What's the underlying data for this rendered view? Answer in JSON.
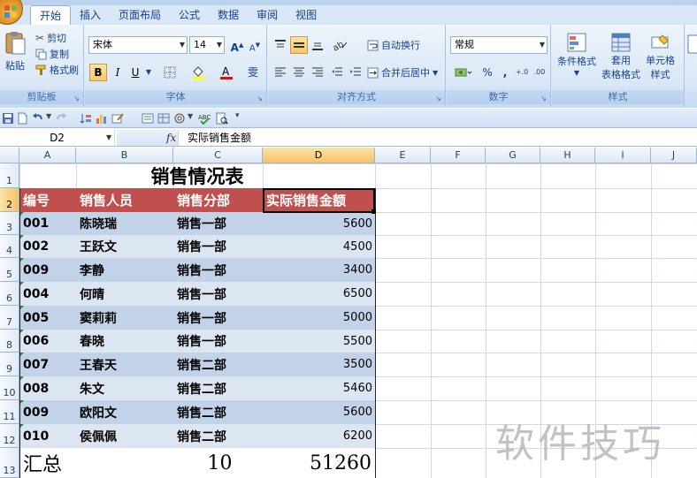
{
  "ribbon": {
    "tabs": [
      "开始",
      "插入",
      "页面布局",
      "公式",
      "数据",
      "审阅",
      "视图"
    ],
    "active_tab": "开始",
    "clipboard": {
      "paste": "粘贴",
      "cut": "剪切",
      "copy": "复制",
      "format_painter": "格式刷",
      "label": "剪贴板"
    },
    "font": {
      "name": "宋体",
      "size": "14",
      "bold": "B",
      "italic": "I",
      "underline": "U",
      "grow": "A",
      "shrink": "A",
      "phonetic": "雯",
      "label": "字体"
    },
    "alignment": {
      "wrap_text": "自动换行",
      "merge_center": "合并后居中",
      "label": "对齐方式"
    },
    "number": {
      "format": "常规",
      "percent": "%",
      "comma": ",",
      "increase_decimal": "+.0",
      "decrease_decimal": ".00",
      "label": "数字"
    },
    "styles": {
      "conditional_format": "条件格式",
      "format_as_table_1": "套用",
      "format_as_table_2": "表格格式",
      "cell_styles_1": "单元格",
      "cell_styles_2": "样式",
      "label": "样式"
    },
    "colors": {
      "accent": "#15428b",
      "highlight_yellow": "#ffff00",
      "font_red": "#ff0000"
    }
  },
  "formula_bar": {
    "name_box": "D2",
    "fx": "fx",
    "content": "实际销售金额"
  },
  "columns": [
    "A",
    "B",
    "C",
    "D",
    "E",
    "F",
    "G",
    "H",
    "I",
    "J"
  ],
  "selected_column": "D",
  "rows": [
    "1",
    "2",
    "3",
    "4",
    "5",
    "6",
    "7",
    "8",
    "9",
    "10",
    "11",
    "12",
    "13"
  ],
  "selected_row": "2",
  "sheet": {
    "title": "销售情况表",
    "headers": [
      "编号",
      "销售人员",
      "销售分部",
      "实际销售金额"
    ],
    "data": [
      [
        "001",
        "陈晓瑞",
        "销售一部",
        "5600"
      ],
      [
        "002",
        "王跃文",
        "销售一部",
        "4500"
      ],
      [
        "009",
        "李静",
        "销售一部",
        "3400"
      ],
      [
        "004",
        "何晴",
        "销售一部",
        "6500"
      ],
      [
        "005",
        "窦莉莉",
        "销售一部",
        "5000"
      ],
      [
        "006",
        "春晓",
        "销售一部",
        "5500"
      ],
      [
        "007",
        "王春天",
        "销售二部",
        "3500"
      ],
      [
        "008",
        "朱文",
        "销售二部",
        "5460"
      ],
      [
        "009",
        "欧阳文",
        "销售二部",
        "5600"
      ],
      [
        "010",
        "侯佩佩",
        "销售二部",
        "6200"
      ]
    ],
    "total": {
      "label": "汇总",
      "count": "10",
      "sum": "51260"
    },
    "header_color": "#c0504d",
    "band_odd_color": "#c2d2e8",
    "band_even_color": "#dce6f2"
  },
  "watermark": "软件技巧"
}
